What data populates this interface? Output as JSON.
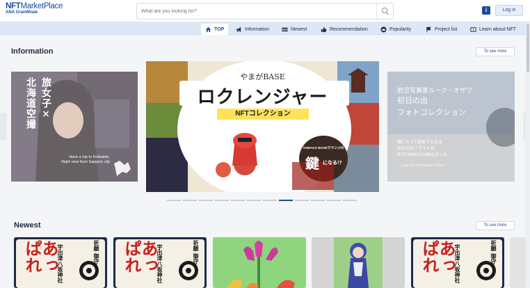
{
  "header": {
    "logo_main": "NFT",
    "logo_main_rest": "MarketPlace",
    "logo_sub": "ANA GranWhale",
    "search_placeholder": "What are you looking for?",
    "info_icon": "i",
    "login_label": "Log in"
  },
  "nav": {
    "items": [
      {
        "label": "TOP",
        "icon": "home-icon"
      },
      {
        "label": "Information",
        "icon": "megaphone-icon"
      },
      {
        "label": "Newest",
        "icon": "new-icon"
      },
      {
        "label": "Recommendation",
        "icon": "thumbs-up-icon"
      },
      {
        "label": "Popularity",
        "icon": "crown-icon"
      },
      {
        "label": "Project list",
        "icon": "flag-icon"
      },
      {
        "label": "Learn about NFT",
        "icon": "book-icon"
      }
    ]
  },
  "information": {
    "title": "Information",
    "see_more": "To see more",
    "left_slide": {
      "vertical_text_1": "旅女子×",
      "vertical_text_2": "北海道空撮",
      "caption": "Have a trip to Hokkaido. Night view from Sapporo city"
    },
    "main_slide": {
      "top_text": "やまがBASE",
      "headline": "ロクレンジャー",
      "subline": "NFTコレクション",
      "badge_small": "YAMAGA BASEラウンジの",
      "badge_big": "鍵",
      "badge_tail": "になる!?"
    },
    "right_slide": {
      "line1": "航空写真家ルーク・オザワ",
      "line2": "初日の出",
      "line3": "フォトコレクション",
      "small1": "僕にとって初めてとなる",
      "small2": "初日の出フライトは",
      "small3": "B747-400D(JA8961)だった",
      "small4": "— Luke_the First Sunrise of 2011 —"
    }
  },
  "newest": {
    "title": "Newest",
    "see_more": "To see more",
    "cards": [
      {
        "kanji_big": "あっぱれ",
        "kanji_side": "宇出津八坂神社",
        "kanji_right": "祈願 御守"
      },
      {
        "kanji_big": "あっぱれ",
        "kanji_side": "宇出津八坂神社",
        "kanji_right": "祈願 御守"
      },
      {
        "kanji_big": "",
        "kanji_side": "",
        "kanji_right": ""
      },
      {
        "kanji_big": "",
        "kanji_side": "",
        "kanji_right": ""
      },
      {
        "kanji_big": "あっぱれ",
        "kanji_side": "宇出津八坂神社",
        "kanji_right": "祈願 御守"
      }
    ]
  },
  "colors": {
    "brand": "#1c4a9b",
    "nav_bg": "#dde8f6",
    "page_bg": "#f4f5f7"
  }
}
